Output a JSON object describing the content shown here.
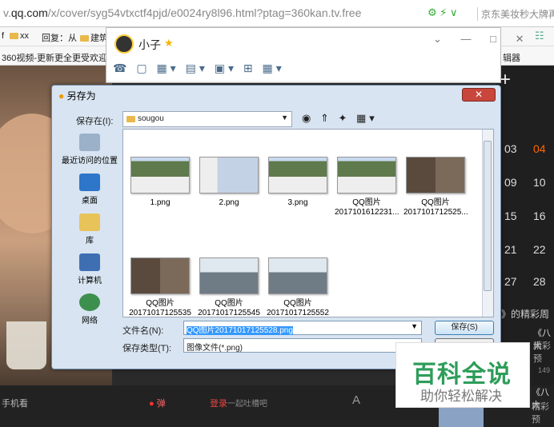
{
  "browser": {
    "url_prefix": "v.",
    "url_domain": "qq.com",
    "url_path": "/x/cover/syg54vtxctf4pjd/e0024ry8l96.html?ptag=360kan.tv.free",
    "url_icons": "⚙ ⚡ ∨",
    "right_text": "京东美妆秒大牌再来",
    "bookmarks": [
      "xx",
      "回复：从",
      "建筑"
    ],
    "bookmark_prefix": "f",
    "bookmarks2": "360视频-更新更全更受欢迎",
    "bookmarks2_right": "辑器",
    "bookmarks_right_icon": "☷"
  },
  "side": {
    "plus": "+",
    "calendar": [
      "03",
      "04",
      "09",
      "10",
      "15",
      "16",
      "21",
      "22",
      "27",
      "28"
    ],
    "text1": "》的精彩周",
    "text2": "《八大",
    "text3": "精彩预",
    "text4": "149",
    "text5": "《八大",
    "text6": "精彩预"
  },
  "bottombar": {
    "left": "手机看",
    "danmu": "弹",
    "login": "登录",
    "login_hint": "一起吐槽吧",
    "a": "A"
  },
  "qq": {
    "name": "小子",
    "star": "★",
    "controls": "⌄ — □ ✕",
    "tools": "☎ ▢ ▦▾ ▤▾ ▣▾ ⊞ ▦▾"
  },
  "dialog": {
    "title": "另存为",
    "close": "✕",
    "save_in_label": "保存在(I):",
    "save_in_value": "sougou",
    "nav_icons": "◉ ⇑ ✦ ▦▾",
    "places": [
      "最近访问的位置",
      "桌面",
      "库",
      "计算机",
      "网络"
    ],
    "files": [
      {
        "label1": "1.png",
        "label2": "",
        "kind": "screen"
      },
      {
        "label1": "2.png",
        "label2": "",
        "kind": "screen2"
      },
      {
        "label1": "3.png",
        "label2": "",
        "kind": "screen"
      },
      {
        "label1": "QQ图片",
        "label2": "2017101612231...",
        "kind": "screen"
      },
      {
        "label1": "QQ图片",
        "label2": "2017101712525...",
        "kind": "photo"
      },
      {
        "label1": "QQ图片",
        "label2": "20171017125535",
        "kind": "photo"
      },
      {
        "label1": "QQ图片",
        "label2": "20171017125545",
        "kind": "photo2"
      },
      {
        "label1": "QQ图片",
        "label2": "20171017125552",
        "kind": "photo2"
      }
    ],
    "filename_label": "文件名(N):",
    "filename_value": "QQ图片20171017125528.png",
    "filetype_label": "保存类型(T):",
    "filetype_value": "图像文件(*.png)",
    "save_button": "保存(S)"
  },
  "watermark": {
    "big": "百科全说",
    "small": "助你轻松解决"
  }
}
